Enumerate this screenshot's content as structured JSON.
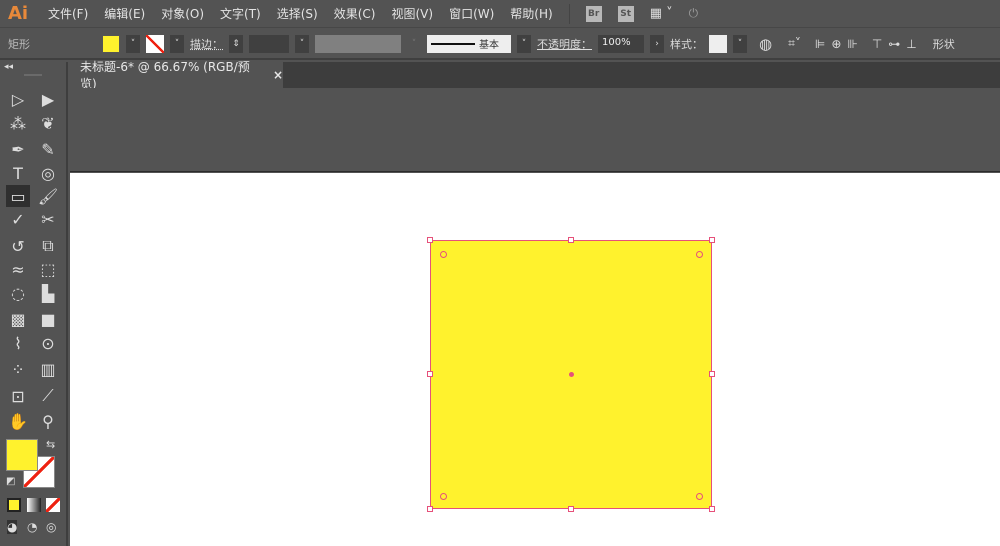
{
  "app": {
    "logo": "Ai"
  },
  "menu": [
    "文件(F)",
    "编辑(E)",
    "对象(O)",
    "文字(T)",
    "选择(S)",
    "效果(C)",
    "视图(V)",
    "窗口(W)",
    "帮助(H)"
  ],
  "menu_icons": {
    "bridge": "Br",
    "stock": "St"
  },
  "control": {
    "object_type": "矩形",
    "fill_color": "#fff22d",
    "stroke_label": "描边：",
    "stroke_profile": "基本",
    "opacity_label": "不透明度：",
    "opacity_value": "100%",
    "style_label": "样式：",
    "shape_label": "形状"
  },
  "document_tab": {
    "title": "未标题-6* @ 66.67% (RGB/预览)",
    "close": "×"
  },
  "colors": {
    "fill": "#fff22d",
    "stroke": "#e6507a"
  },
  "tools": [
    "selection",
    "direct-selection",
    "magic-wand",
    "lasso",
    "pen",
    "curvature",
    "type",
    "spiral",
    "rectangle",
    "paintbrush",
    "shaper",
    "scissors",
    "rotate",
    "scale",
    "warp",
    "free-transform",
    "shape-builder",
    "perspective-grid",
    "mesh",
    "gradient",
    "eyedropper",
    "blend",
    "symbol-sprayer",
    "column-graph",
    "artboard",
    "slice",
    "hand",
    "zoom"
  ]
}
